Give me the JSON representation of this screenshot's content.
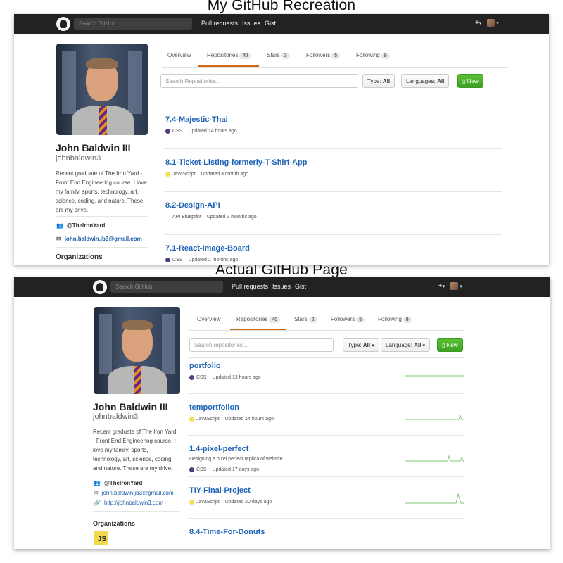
{
  "captions": {
    "top": "My GitHub Recreation",
    "bottom": "Actual GitHub Page"
  },
  "header": {
    "search_placeholder": "Search GitHub",
    "nav_links": [
      "Pull requests",
      "Issues",
      "Gist"
    ],
    "plus": "+",
    "icons": [
      "github-logo-icon",
      "plus-icon",
      "avatar-icon",
      "chevron-down-icon"
    ]
  },
  "profile": {
    "name": "John Baldwin III",
    "login": "johnbaldwin3",
    "organization": "@TheIronYard",
    "email": "john.baldwin.jb3@gmail.com",
    "website": "http://johnbaldwin3.com",
    "orgs_label": "Organizations",
    "org_badge": "JS"
  },
  "recreation": {
    "bio_lines": [
      "Recent graduate of The Iron Yard -",
      "Front End Engineering course. I love",
      "my family, sports, technology, art,",
      "science, coding, and nature. These",
      "are my drive."
    ],
    "tabs": [
      {
        "label": "Overview",
        "count": ""
      },
      {
        "label": "Repositories",
        "count": "40"
      },
      {
        "label": "Stars",
        "count": "3"
      },
      {
        "label": "Followers",
        "count": "5"
      },
      {
        "label": "Following",
        "count": "9"
      }
    ],
    "search_placeholder": "Search Repositories...",
    "type_label": "Type:",
    "type_value": "All",
    "language_label": "Languages:",
    "language_value": "All",
    "new_label": "New",
    "repos": [
      {
        "name": "7.4-Majestic-Thai",
        "language": "CSS",
        "color": "#563d7c",
        "updated": "Updated 14 hours ago"
      },
      {
        "name": "8.1-Ticket-Listing-formerly-T-Shirt-App",
        "language": "JavaScript",
        "color": "#f1e05a",
        "updated": "Updated a month ago"
      },
      {
        "name": "8.2-Design-API",
        "language": "API Blueprint",
        "color": "",
        "updated": "Updated 2 months ago"
      },
      {
        "name": "7.1-React-Image-Board",
        "language": "CSS",
        "color": "#563d7c",
        "updated": "Updated 2 months ago"
      }
    ]
  },
  "actual": {
    "bio_lines": [
      "Recent graduate of The Iron Yard",
      "- Front End Engineering course. I",
      "love my family, sports,",
      "technology, art, science, coding,",
      "and nature. These are my drive."
    ],
    "tabs": [
      {
        "label": "Overview",
        "count": ""
      },
      {
        "label": "Repositories",
        "count": "40"
      },
      {
        "label": "Stars",
        "count": "2"
      },
      {
        "label": "Followers",
        "count": "5"
      },
      {
        "label": "Following",
        "count": "9"
      }
    ],
    "search_placeholder": "Search repositories...",
    "type_label": "Type:",
    "type_value": "All",
    "language_label": "Language:",
    "language_value": "All",
    "new_label": "New",
    "repos": [
      {
        "name": "portfolio",
        "description": "",
        "language": "CSS",
        "color": "#563d7c",
        "updated": "Updated 13 hours ago"
      },
      {
        "name": "temportfolion",
        "description": "",
        "language": "JavaScript",
        "color": "#f1e05a",
        "updated": "Updated 14 hours ago"
      },
      {
        "name": "1.4-pixel-perfect",
        "description": "Designing a pixel perfect replica of website",
        "language": "CSS",
        "color": "#563d7c",
        "updated": "Updated 17 days ago"
      },
      {
        "name": "TIY-Final-Project",
        "description": "",
        "language": "JavaScript",
        "color": "#f1e05a",
        "updated": "Updated 20 days ago"
      },
      {
        "name": "8.4-Time-For-Donuts",
        "description": "",
        "language": "",
        "color": "",
        "updated": ""
      }
    ]
  }
}
